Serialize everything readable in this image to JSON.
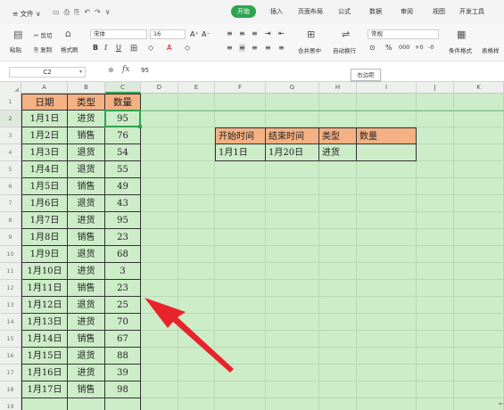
{
  "menubar": {
    "file_label": "≡ 文件 ∨",
    "quick_icons": [
      "▭",
      "⎙",
      "⎘",
      "↶",
      "↷",
      "∨"
    ],
    "tabs": [
      {
        "label": "开始",
        "active": true
      },
      {
        "label": "插入",
        "active": false
      },
      {
        "label": "页面布局",
        "active": false
      },
      {
        "label": "公式",
        "active": false
      },
      {
        "label": "数据",
        "active": false
      },
      {
        "label": "审阅",
        "active": false
      },
      {
        "label": "视图",
        "active": false
      },
      {
        "label": "开发工具",
        "active": false
      }
    ]
  },
  "ribbon": {
    "paste_label": "粘贴",
    "cut_label": "✂ 剪切",
    "copy_label": "复制",
    "format_painter_label": "格式刷",
    "font_name": "宋体",
    "font_size": "16",
    "grow_font": "A⁺",
    "shrink_font": "A⁻",
    "bold": "B",
    "italic": "I",
    "underline": "U",
    "border_icon": "田",
    "fill_icon": "◇",
    "font_color": "A",
    "erase_icon": "◇",
    "merge_label": "合并居中",
    "wrap_label": "自动换行",
    "number_format": "常规",
    "percent_label": "%",
    "thousands_label": "000",
    "dec_inc": "+0",
    "dec_dec": "-0",
    "cond_format_label": "条件格式",
    "table_style_label": "表格样"
  },
  "formula_bar": {
    "name_box": "C2",
    "fx": "fx",
    "value": "95",
    "tooltip": "右边距"
  },
  "columns": [
    "A",
    "B",
    "C",
    "D",
    "E",
    "F",
    "G",
    "H",
    "I",
    "J",
    "K"
  ],
  "active_column": "C",
  "active_row": "2",
  "rows": [
    "1",
    "2",
    "3",
    "4",
    "5",
    "6",
    "7",
    "8",
    "9",
    "10",
    "11",
    "12",
    "13",
    "14",
    "15",
    "16",
    "17",
    "18",
    "19"
  ],
  "table_headers": {
    "date": "日期",
    "type": "类型",
    "qty": "数量"
  },
  "table_rows": [
    {
      "date": "1月1日",
      "type": "进货",
      "qty": "95"
    },
    {
      "date": "1月2日",
      "type": "销售",
      "qty": "76"
    },
    {
      "date": "1月3日",
      "type": "退货",
      "qty": "54"
    },
    {
      "date": "1月4日",
      "type": "退货",
      "qty": "55"
    },
    {
      "date": "1月5日",
      "type": "销售",
      "qty": "49"
    },
    {
      "date": "1月6日",
      "type": "退货",
      "qty": "43"
    },
    {
      "date": "1月7日",
      "type": "进货",
      "qty": "95"
    },
    {
      "date": "1月8日",
      "type": "销售",
      "qty": "23"
    },
    {
      "date": "1月9日",
      "type": "退货",
      "qty": "68"
    },
    {
      "date": "1月10日",
      "type": "进货",
      "qty": "3"
    },
    {
      "date": "1月11日",
      "type": "销售",
      "qty": "23"
    },
    {
      "date": "1月12日",
      "type": "退货",
      "qty": "25"
    },
    {
      "date": "1月13日",
      "type": "进货",
      "qty": "70"
    },
    {
      "date": "1月14日",
      "type": "销售",
      "qty": "67"
    },
    {
      "date": "1月15日",
      "type": "退货",
      "qty": "88"
    },
    {
      "date": "1月16日",
      "type": "进货",
      "qty": "39"
    },
    {
      "date": "1月17日",
      "type": "销售",
      "qty": "98"
    }
  ],
  "criteria": {
    "headers": [
      "开始时间",
      "结束时间",
      "类型",
      "数量"
    ],
    "values": [
      "1月1日",
      "1月20日",
      "进货",
      ""
    ]
  },
  "colors": {
    "sheet_bg": "#cdecc8",
    "header_fill": "#f4b183",
    "accent": "#2ea44f",
    "arrow": "#e8242a"
  }
}
